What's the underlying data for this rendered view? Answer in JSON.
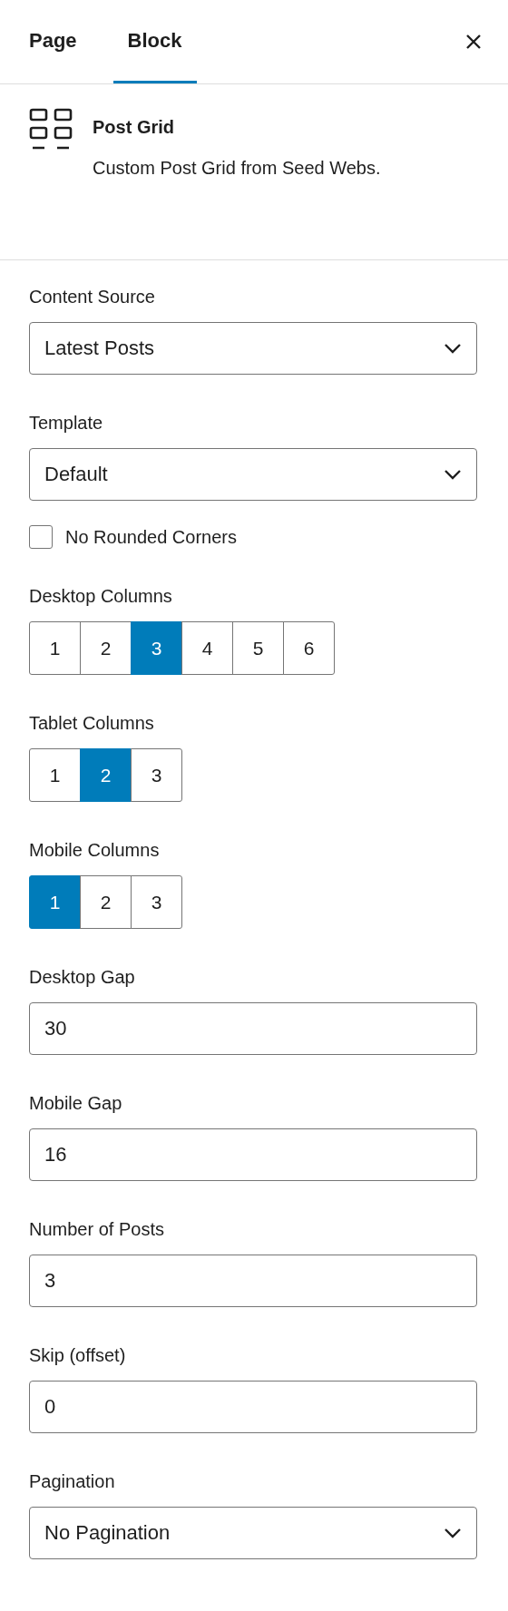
{
  "tabs": [
    {
      "label": "Page",
      "selected": false
    },
    {
      "label": "Block",
      "selected": true
    }
  ],
  "block": {
    "title": "Post Grid",
    "description": "Custom Post Grid from Seed Webs."
  },
  "controls": [
    {
      "kind": "select",
      "label": "Content Source",
      "value": "Latest Posts"
    },
    {
      "kind": "select",
      "label": "Template",
      "value": "Default"
    },
    {
      "kind": "checkbox",
      "label": "No Rounded Corners",
      "checked": false
    },
    {
      "kind": "buttons",
      "label": "Desktop Columns",
      "options": [
        {
          "label": "1",
          "selected": false
        },
        {
          "label": "2",
          "selected": false
        },
        {
          "label": "3",
          "selected": true
        },
        {
          "label": "4",
          "selected": false
        },
        {
          "label": "5",
          "selected": false
        },
        {
          "label": "6",
          "selected": false
        }
      ]
    },
    {
      "kind": "buttons",
      "label": "Tablet Columns",
      "options": [
        {
          "label": "1",
          "selected": false
        },
        {
          "label": "2",
          "selected": true
        },
        {
          "label": "3",
          "selected": false
        }
      ]
    },
    {
      "kind": "buttons",
      "label": "Mobile Columns",
      "options": [
        {
          "label": "1",
          "selected": true
        },
        {
          "label": "2",
          "selected": false
        },
        {
          "label": "3",
          "selected": false
        }
      ]
    },
    {
      "kind": "number",
      "label": "Desktop Gap",
      "value": "30"
    },
    {
      "kind": "number",
      "label": "Mobile Gap",
      "value": "16"
    },
    {
      "kind": "number",
      "label": "Number of Posts",
      "value": "3"
    },
    {
      "kind": "number",
      "label": "Skip (offset)",
      "value": "0"
    },
    {
      "kind": "select",
      "label": "Pagination",
      "value": "No Pagination"
    }
  ]
}
